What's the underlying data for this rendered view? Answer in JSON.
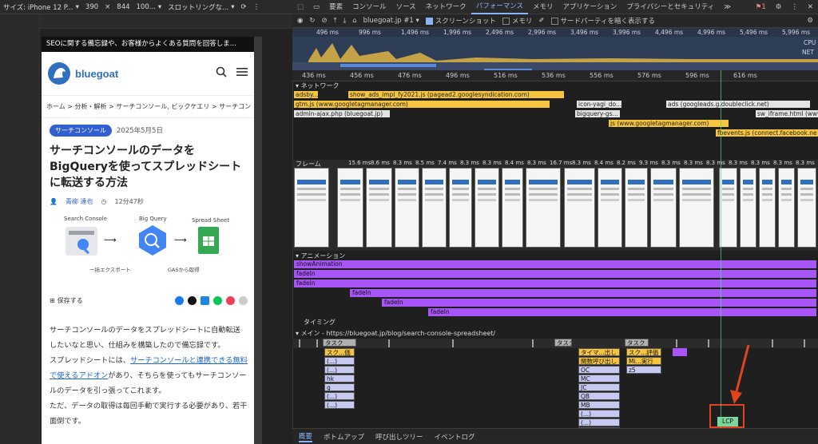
{
  "device_toolbar": {
    "device": "サイズ: iPhone 12 P...",
    "width": "390",
    "height": "844",
    "zoom": "100...",
    "throttle": "スロットリングな..."
  },
  "site": {
    "banner": "SEOに関する備忘録や、お客様からよくある質問を回答しま...",
    "logo_text": "bluegoat",
    "breadcrumb": "ホーム > 分析・解析 > サーチコンソール, ビックケエリ > サーチコン",
    "category": "サーチコンソール",
    "date": "2025年5月5日",
    "title": "サーチコンソールのデータをBigQueryを使ってスプレッドシートに転送する方法",
    "author": "青柳 達也",
    "read_time": "12分47秒",
    "fig_labels": {
      "sc": "Search Console",
      "bq": "Big Query",
      "ss": "Spread Sheet",
      "export": "一括エクスポート",
      "gas": "GASから取得"
    },
    "save": "保存する",
    "body": [
      "サーチコンソールのデータをスプレッドシートに自動転送したいなと思い、仕組みを構築したので備忘録です。",
      "スプレッドシートには、",
      "サーチコンソールと連携できる無料で使えるアドオン",
      "があり、そちらを使ってもサーチコンソールのデータを引っ張ってこれます。",
      "ただ、データの取得は毎回手動で実行する必要があり、若干面倒です。"
    ]
  },
  "devtools": {
    "tabs": [
      "要素",
      "コンソール",
      "ソース",
      "ネットワーク",
      "パフォーマンス",
      "メモリ",
      "アプリケーション",
      "プライバシーとセキュリティ"
    ],
    "active_tab": "パフォーマンス",
    "more": "≫",
    "badge": "1",
    "toolbar": {
      "profile": "bluegoat.jp #1",
      "screenshot": "スクリーンショット",
      "memory": "メモリ",
      "third_party": "サードパーティを暗く表示する"
    },
    "overview_ticks": [
      "496 ms",
      "996 ms",
      "1,496 ms",
      "1,996 ms",
      "2,496 ms",
      "2,996 ms",
      "3,496 ms",
      "3,996 ms",
      "4,496 ms",
      "4,996 ms",
      "5,496 ms",
      "5,996 ms"
    ],
    "overview_labels": {
      "cpu": "CPU",
      "net": "NET"
    },
    "ruler_ticks": [
      "436 ms",
      "456 ms",
      "476 ms",
      "496 ms",
      "516 ms",
      "536 ms",
      "556 ms",
      "576 ms",
      "596 ms",
      "616 ms"
    ],
    "network_label": "ネットワーク",
    "network": [
      {
        "name": "adsby...",
        "color": "y"
      },
      {
        "name": "show_ads_impl_fy2021.js (pagead2.googlesyndication.com)",
        "color": "y"
      },
      {
        "name": "gtm.js (www.googletagmanager.com)",
        "color": "y"
      },
      {
        "name": "admin-ajax.php (bluegoat.jp)",
        "color": "g"
      },
      {
        "name": "icon-yagi_do...",
        "color": "g"
      },
      {
        "name": "ads (googleads.g.doubleclick.net)",
        "color": "g"
      },
      {
        "name": "bigquery-gs...",
        "color": "g"
      },
      {
        "name": "sw_iframe.html (www...",
        "color": "g"
      },
      {
        "name": "js (www.googletagmanager.com)",
        "color": "y"
      },
      {
        "name": "fbevents.js (connect.facebook.ne",
        "color": "y"
      }
    ],
    "frame_label": "フレーム",
    "frame_times": [
      "15.6 ms",
      "8.6 ms",
      "8.3 ms",
      "8.5 ms",
      "7.4 ms",
      "8.3 ms",
      "8.3 ms",
      "8.4 ms",
      "8.3 ms",
      "16.7 ms",
      "8.3 ms",
      "8.4 ms",
      "8.2 ms",
      "9.3 ms",
      "8.3 ms",
      "8.3 ms",
      "8.3 ms",
      "8.3 ms",
      "8.3 ms",
      "8.3 ms",
      "8.3 ms"
    ],
    "animation_label": "アニメーション",
    "animations": [
      "showAnimation",
      "fadeIn",
      "fadeIn",
      "fadeIn",
      "fadeIn",
      "fadeIn"
    ],
    "timing_label": "タイミング",
    "main_label": "メイン - https://bluegoat.jp/blog/search-console-spreadsheet/",
    "flame": {
      "task": "タスク",
      "col1": [
        "スク...価",
        "(...)",
        "(...)",
        "hk",
        "g",
        "(...)",
        "(...)"
      ],
      "col2": [
        "タイマ...出し",
        "関数呼び出し",
        "OC",
        "MC",
        "JC",
        "QB",
        "MB",
        "(...)",
        "(...)",
        "(...)"
      ],
      "col3": [
        "スク...評価",
        "Mi...実行",
        "z5"
      ]
    },
    "lcp": "LCP",
    "bottom_tabs": [
      "概要",
      "ボトムアップ",
      "呼び出しツリー",
      "イベントログ"
    ]
  }
}
